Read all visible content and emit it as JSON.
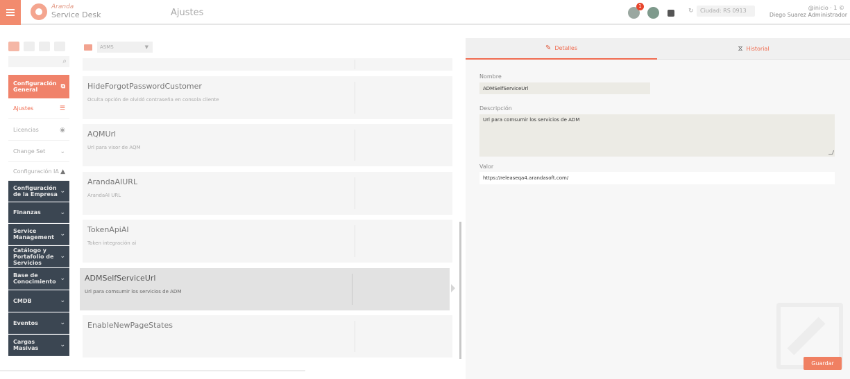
{
  "app": {
    "logo_top": "Aranda",
    "logo_bottom": "Service Desk",
    "page_title": "Ajustes"
  },
  "header": {
    "notification_count": "1",
    "instance_label": "Ciudad: RS 0913",
    "user_top": "@inicio · 1 ©",
    "user_bottom": "Diego Suarez Administrador"
  },
  "nav": {
    "filter_value": "ASMS",
    "items": [
      {
        "label": "Configuración General",
        "icon": "settings-icon"
      },
      {
        "label": "Ajustes",
        "icon": "sliders-icon"
      },
      {
        "label": "Licencias",
        "icon": "license-icon"
      },
      {
        "label": "Change Set",
        "icon": "chevron-down-icon"
      },
      {
        "label": "Configuración IA",
        "icon": "bot-icon"
      },
      {
        "label": "Configuración de la Empresa",
        "icon": "chevron-down-icon"
      },
      {
        "label": "Finanzas",
        "icon": "chevron-down-icon"
      },
      {
        "label": "Service Management",
        "icon": "chevron-down-icon"
      },
      {
        "label": "Catálogo y Portafolio de Servicios",
        "icon": "chevron-down-icon"
      },
      {
        "label": "Base de Conocimiento",
        "icon": "chevron-down-icon"
      },
      {
        "label": "CMDB",
        "icon": "chevron-down-icon"
      },
      {
        "label": "Eventos",
        "icon": "chevron-down-icon"
      },
      {
        "label": "Cargas Masivas",
        "icon": "chevron-down-icon"
      }
    ]
  },
  "settings_list": [
    {
      "title": "",
      "desc": ""
    },
    {
      "title": "HideForgotPasswordCustomer",
      "desc": "Oculta opción de olvidó contraseña en consola cliente"
    },
    {
      "title": "AQMUrl",
      "desc": "Url para visor de AQM"
    },
    {
      "title": "ArandaAIURL",
      "desc": "ArandaAI URL"
    },
    {
      "title": "TokenApiAI",
      "desc": "Token integración ai"
    },
    {
      "title": "ADMSelfServiceUrl",
      "desc": "Url para comsumir los servicios de ADM"
    },
    {
      "title": "EnableNewPageStates",
      "desc": ""
    }
  ],
  "detail": {
    "tabs": {
      "details": "Detalles",
      "history": "Historial"
    },
    "name_label": "Nombre",
    "name_value": "ADMSelfServiceUrl",
    "desc_label": "Descripción",
    "desc_value": "Url para comsumir los servicios de ADM",
    "value_label": "Valor",
    "value_value": "https://releaseqa4.arandasoft.com/",
    "save_label": "Guardar"
  },
  "colors": {
    "accent": "#f0826a",
    "nav_dark": "#3b4652",
    "badge": "#e8452c"
  }
}
